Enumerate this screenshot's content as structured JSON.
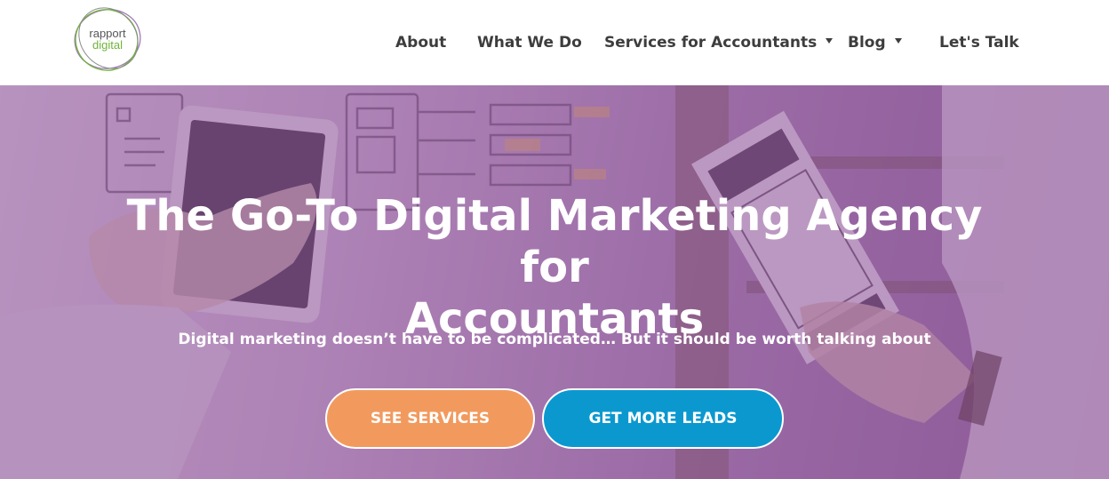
{
  "logo": {
    "line1": "rapport",
    "line2": "digital"
  },
  "nav": {
    "items": [
      {
        "label": "About",
        "has_dropdown": false
      },
      {
        "label": "What We Do",
        "has_dropdown": false
      },
      {
        "label": "Services for Accountants",
        "has_dropdown": true
      },
      {
        "label": "Blog",
        "has_dropdown": true
      },
      {
        "label": "Let's Talk",
        "has_dropdown": false
      }
    ]
  },
  "hero": {
    "title_line1": "The Go-To Digital Marketing Agency for",
    "title_line2": "Accountants",
    "subtitle": "Digital marketing doesn’t have to be complicated… But it should be worth talking about",
    "buttons": {
      "services": "SEE SERVICES",
      "leads": "GET MORE LEADS"
    }
  },
  "colors": {
    "overlay": "#8a4e96",
    "services_button": "#f29a5e",
    "leads_button": "#0b98cf",
    "nav_text": "#3d3d3d",
    "logo_green": "#6fb33a"
  }
}
